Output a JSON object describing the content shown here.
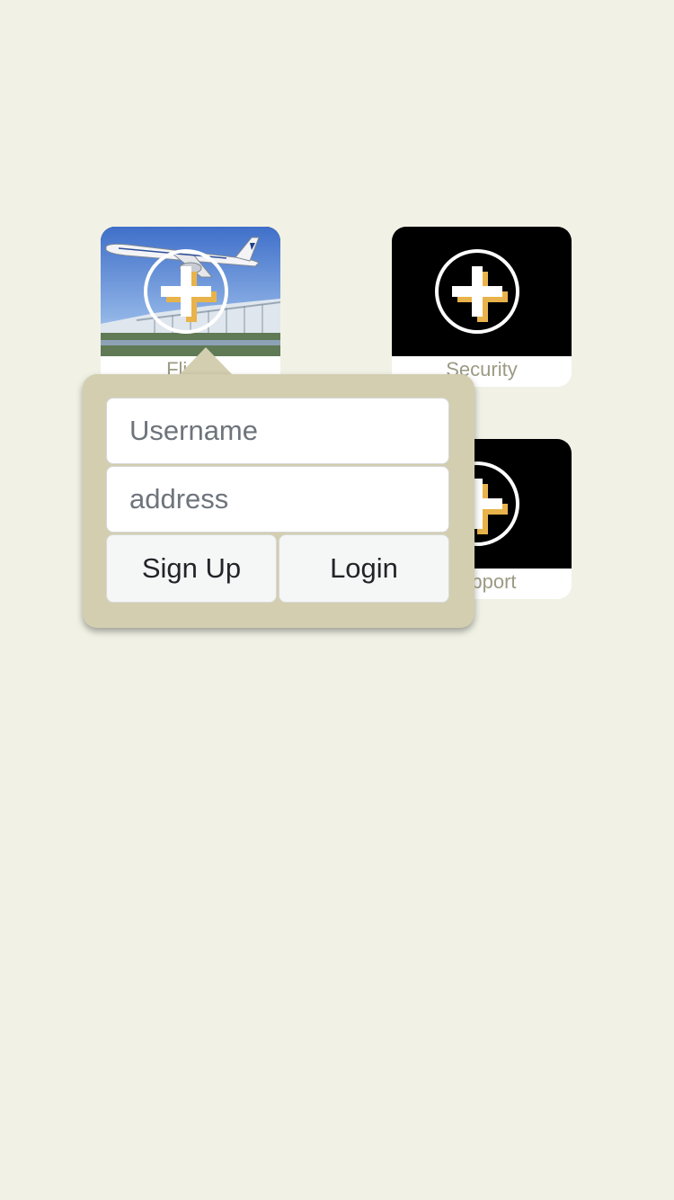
{
  "tiles": [
    {
      "label": "Flight",
      "icon": "plus-circle-icon",
      "image": "airplane-photo"
    },
    {
      "label": "Security",
      "icon": "plus-circle-icon"
    },
    {
      "label": "Support",
      "icon": "plus-circle-icon"
    }
  ],
  "popover": {
    "username": {
      "placeholder": "Username",
      "value": ""
    },
    "address": {
      "placeholder": "address",
      "value": ""
    },
    "signup_label": "Sign Up",
    "login_label": "Login"
  },
  "colors": {
    "background": "#f1f2e5",
    "popover": "#d3ceb0",
    "tile_label": "#9c9a83",
    "plus_accent": "#e8b34a"
  }
}
